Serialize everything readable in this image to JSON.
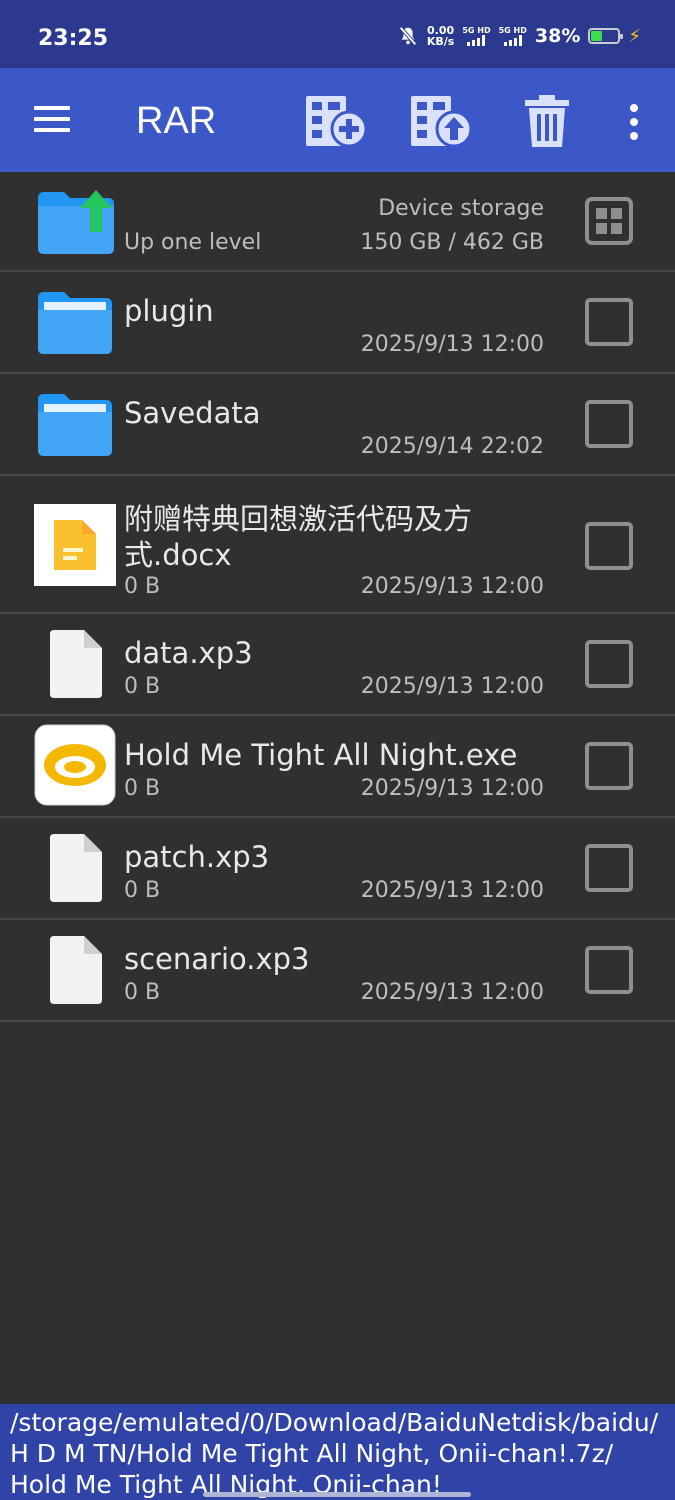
{
  "status": {
    "time": "23:25",
    "speed_top": "0.00",
    "speed_bottom": "KB/s",
    "sig1": "5G HD",
    "sig2": "5G HD",
    "battery": "38%",
    "battery_level": 0.38
  },
  "appbar": {
    "title": "RAR",
    "icons": [
      "menu-icon",
      "add-to-archive-icon",
      "extract-icon",
      "delete-icon",
      "more-vert-icon"
    ]
  },
  "up": {
    "label": "Up one level",
    "storage_label": "Device storage",
    "storage_value": "150 GB / 462 GB"
  },
  "files": [
    {
      "name": "plugin",
      "size": "",
      "date": "2025/9/13 12:00",
      "icon": "folder-icon"
    },
    {
      "name": "Savedata",
      "size": "",
      "date": "2025/9/14 22:02",
      "icon": "folder-icon"
    },
    {
      "name_line1": "附赠特典回想激活代码及方",
      "name_line2": "式.docx",
      "size": "0 B",
      "date": "2025/9/13 12:00",
      "icon": "docx-icon"
    },
    {
      "name": "data.xp3",
      "size": "0 B",
      "date": "2025/9/13 12:00",
      "icon": "file-icon"
    },
    {
      "name": "Hold Me Tight All Night.exe",
      "size": "0 B",
      "date": "2025/9/13 12:00",
      "icon": "exe-app-icon"
    },
    {
      "name": "patch.xp3",
      "size": "0 B",
      "date": "2025/9/13 12:00",
      "icon": "file-icon"
    },
    {
      "name": "scenario.xp3",
      "size": "0 B",
      "date": "2025/9/13 12:00",
      "icon": "file-icon"
    }
  ],
  "path": {
    "line1": "/storage/emulated/0/Download/BaiduNetdisk/baidu/",
    "line2": "H D M TN/Hold Me Tight All Night, Onii-chan!.7z/",
    "line3": "Hold Me Tight All Night, Onii-chan!"
  }
}
